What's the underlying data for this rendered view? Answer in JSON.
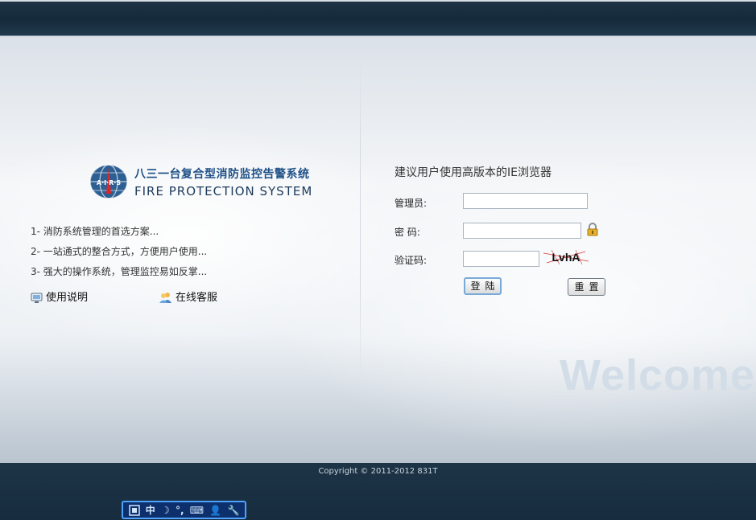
{
  "logo": {
    "emblem_text": "A·I·R·S",
    "title_cn": "八三一台复合型消防监控告警系统",
    "title_en": "FIRE PROTECTION SYSTEM"
  },
  "features": [
    "1- 消防系统管理的首选方案...",
    "2- 一站通式的整合方式，方便用户使用...",
    "3- 强大的操作系统，管理监控易如反掌..."
  ],
  "links": {
    "manual": "使用说明",
    "support": "在线客服"
  },
  "login": {
    "title": "建议用户使用高版本的IE浏览器",
    "admin_label": "管理员:",
    "admin_value": "",
    "password_label": "密  码:",
    "password_value": "",
    "captcha_label": "验证码:",
    "captcha_value": "",
    "captcha_image_text": "LvhA",
    "login_button": "登陆",
    "reset_button": "重置"
  },
  "welcome_text": "Welcome",
  "footer": {
    "copyright": "Copyright © 2011-2012 831T"
  },
  "ime_bar": {
    "items": [
      "中",
      "☽",
      "°,",
      "⌨",
      "👤",
      "🔧"
    ]
  },
  "colors": {
    "header_bg": "#1f3344",
    "brand_blue": "#1d4f86",
    "footer_bg": "#1d3446"
  }
}
